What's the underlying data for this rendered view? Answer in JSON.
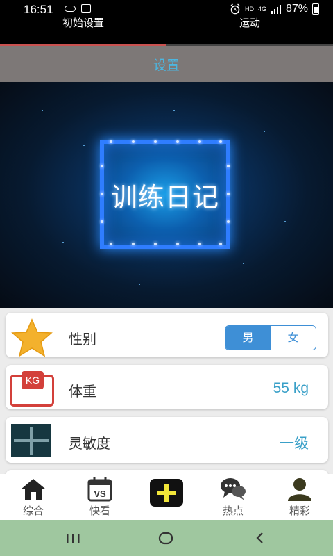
{
  "status_bar": {
    "time": "16:51",
    "hd": "HD",
    "network": "4G",
    "battery": "87%"
  },
  "top_tabs": [
    {
      "label": "初始设置",
      "active": true
    },
    {
      "label": "运动",
      "active": false
    }
  ],
  "header": {
    "title": "设置"
  },
  "banner": {
    "title": "训练日记"
  },
  "settings": {
    "gender": {
      "label": "性别",
      "icon": "star-icon",
      "options": [
        "男",
        "女"
      ],
      "selected": "男"
    },
    "weight": {
      "label": "体重",
      "icon": "kg-scale-icon",
      "icon_text": "KG",
      "value": "55 kg"
    },
    "agility": {
      "label": "灵敏度",
      "icon": "plus-icon",
      "value": "一级"
    }
  },
  "bottom_nav": [
    {
      "label": "综合",
      "icon": "home-icon"
    },
    {
      "label": "快看",
      "icon": "vs-calendar-icon",
      "icon_text": "VS"
    },
    {
      "label": "",
      "icon": "add-icon"
    },
    {
      "label": "热点",
      "icon": "chat-bubbles-icon"
    },
    {
      "label": "精彩",
      "icon": "person-icon"
    }
  ],
  "colors": {
    "accent": "#3aa0c8",
    "toggle": "#3e8fd6",
    "tab_indicator": "#c9514f",
    "header_bg": "#7d7877",
    "system_nav_bg": "#9fc79f"
  }
}
